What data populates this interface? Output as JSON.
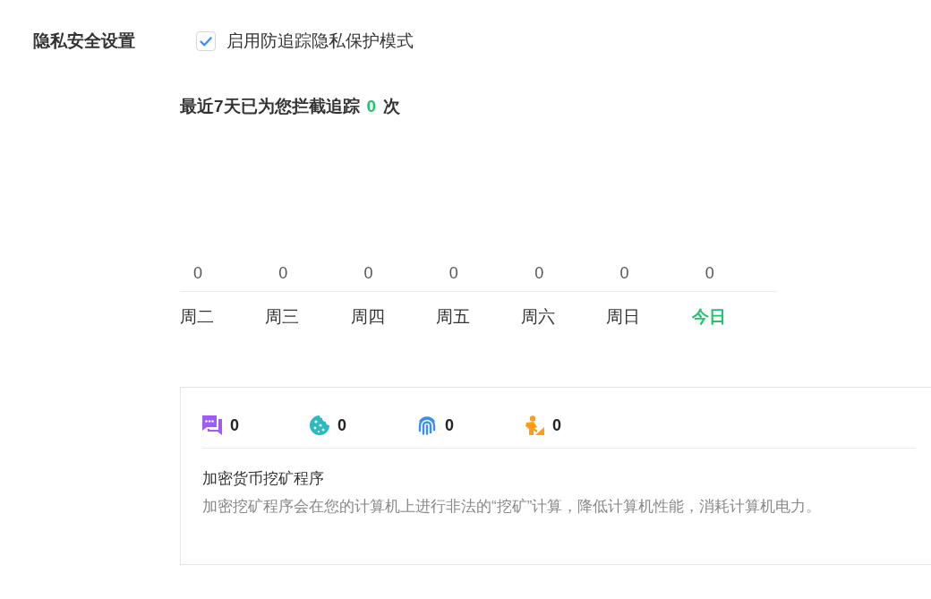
{
  "section": {
    "title": "隐私安全设置"
  },
  "tracking_protection": {
    "label": "启用防追踪隐私保护模式",
    "checked": true
  },
  "summary": {
    "prefix": "最近7天已为您拦截追踪",
    "count": "0",
    "suffix": "次"
  },
  "daily_counts": [
    {
      "day": "周二",
      "count": "0",
      "current": false
    },
    {
      "day": "周三",
      "count": "0",
      "current": false
    },
    {
      "day": "周四",
      "count": "0",
      "current": false
    },
    {
      "day": "周五",
      "count": "0",
      "current": false
    },
    {
      "day": "周六",
      "count": "0",
      "current": false
    },
    {
      "day": "周日",
      "count": "0",
      "current": false
    },
    {
      "day": "今日",
      "count": "0",
      "current": true
    }
  ],
  "tracker_types": [
    {
      "count": "0",
      "color": "#9d5cf5"
    },
    {
      "count": "0",
      "color": "#2bbac2"
    },
    {
      "count": "0",
      "color": "#3a8ef6"
    },
    {
      "count": "0",
      "color": "#ff9c1b"
    }
  ],
  "detail": {
    "title": "加密货币挖矿程序",
    "description": "加密挖矿程序会在您的计算机上进行非法的“挖矿”计算，降低计算机性能，消耗计算机电力。"
  }
}
